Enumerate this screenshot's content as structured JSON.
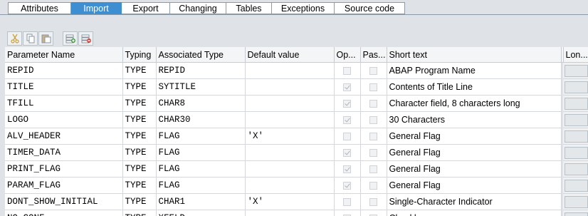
{
  "tabs": [
    {
      "label": "Attributes",
      "active": false
    },
    {
      "label": "Import",
      "active": true
    },
    {
      "label": "Export",
      "active": false
    },
    {
      "label": "Changing",
      "active": false
    },
    {
      "label": "Tables",
      "active": false
    },
    {
      "label": "Exceptions",
      "active": false
    },
    {
      "label": "Source code",
      "active": false
    }
  ],
  "toolbar": {
    "icons": [
      "cut-icon",
      "copy-icon",
      "paste-icon",
      "insert-row-icon",
      "delete-row-icon"
    ]
  },
  "table": {
    "headers": {
      "name": "Parameter Name",
      "typing": "Typing",
      "assoc": "Associated Type",
      "default": "Default value",
      "optional": "Op...",
      "pass": "Pas...",
      "short": "Short text",
      "long": "Lon..."
    },
    "rows": [
      {
        "name": "REPID",
        "typing": "TYPE",
        "assoc": "REPID",
        "default": "",
        "optional": false,
        "pass": false,
        "short": "ABAP Program Name"
      },
      {
        "name": "TITLE",
        "typing": "TYPE",
        "assoc": "SYTITLE",
        "default": "",
        "optional": true,
        "pass": false,
        "short": "Contents of Title Line"
      },
      {
        "name": "TFILL",
        "typing": "TYPE",
        "assoc": "CHAR8",
        "default": "",
        "optional": true,
        "pass": false,
        "short": "Character field, 8 characters long"
      },
      {
        "name": "LOGO",
        "typing": "TYPE",
        "assoc": "CHAR30",
        "default": "",
        "optional": true,
        "pass": false,
        "short": "30 Characters"
      },
      {
        "name": "ALV_HEADER",
        "typing": "TYPE",
        "assoc": "FLAG",
        "default": "'X'",
        "optional": false,
        "pass": false,
        "short": "General Flag"
      },
      {
        "name": "TIMER_DATA",
        "typing": "TYPE",
        "assoc": "FLAG",
        "default": "",
        "optional": true,
        "pass": false,
        "short": "General Flag"
      },
      {
        "name": "PRINT_FLAG",
        "typing": "TYPE",
        "assoc": "FLAG",
        "default": "",
        "optional": true,
        "pass": false,
        "short": "General Flag"
      },
      {
        "name": "PARAM_FLAG",
        "typing": "TYPE",
        "assoc": "FLAG",
        "default": "",
        "optional": true,
        "pass": false,
        "short": "General Flag"
      },
      {
        "name": "DONT_SHOW_INITIAL",
        "typing": "TYPE",
        "assoc": "CHAR1",
        "default": "'X'",
        "optional": false,
        "pass": false,
        "short": "Single-Character Indicator"
      },
      {
        "name": "NO_CONF",
        "typing": "TYPE",
        "assoc": "XFELD",
        "default": "",
        "optional": true,
        "pass": false,
        "short": "Checkbox"
      }
    ]
  }
}
